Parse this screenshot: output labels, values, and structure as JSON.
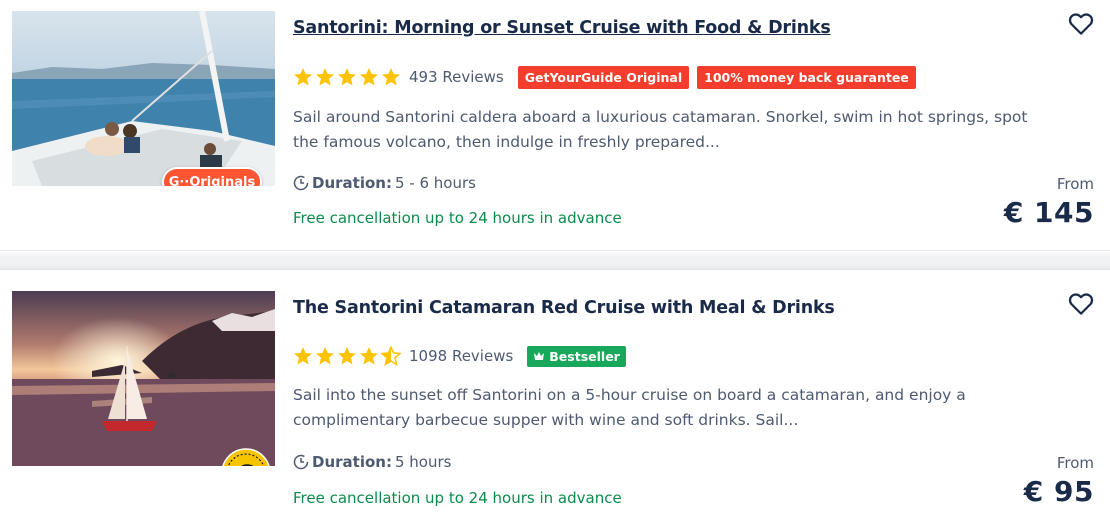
{
  "listings": [
    {
      "title": "Santorini: Morning or Sunset Cruise with Food & Drinks",
      "rating": 5,
      "reviews": "493 Reviews",
      "badges": [
        "GetYourGuide Original",
        "100% money back guarantee"
      ],
      "description_line1": "Sail around Santorini caldera aboard a luxurious catamaran. Snorkel, swim in hot springs, spot",
      "description_line2": "the famous volcano, then indulge in freshly prepared...",
      "duration_label": "Duration:",
      "duration_value": " 5 - 6 hours",
      "free_cancellation": "Free cancellation up to 24 hours in advance",
      "from_label": "From",
      "price": "€ 145",
      "image_badge": "G··Originals",
      "image_icon": "catamaran-lounge-photo"
    },
    {
      "title": "The Santorini Catamaran Red Cruise with Meal & Drinks",
      "rating": 4.5,
      "reviews": "1098 Reviews",
      "badges": [
        "Bestseller"
      ],
      "description_line1": "Sail into the sunset off Santorini on a 5-hour cruise on board a catamaran, and enjoy a",
      "description_line2": "complimentary barbecue supper with wine and soft drinks. Sail...",
      "duration_label": "Duration:",
      "duration_value": " 5 hours",
      "free_cancellation": "Free cancellation up to 24 hours in advance",
      "from_label": "From",
      "price": "€ 95",
      "image_badge_icon": "gyg-coin-icon",
      "image_icon": "sunset-catamaran-photo"
    }
  ],
  "colors": {
    "title": "#1a2b49",
    "star": "#fdc200",
    "badge_orange": "#f53d2d",
    "badge_green": "#18a85b",
    "free_cancel": "#0c8a4c"
  }
}
